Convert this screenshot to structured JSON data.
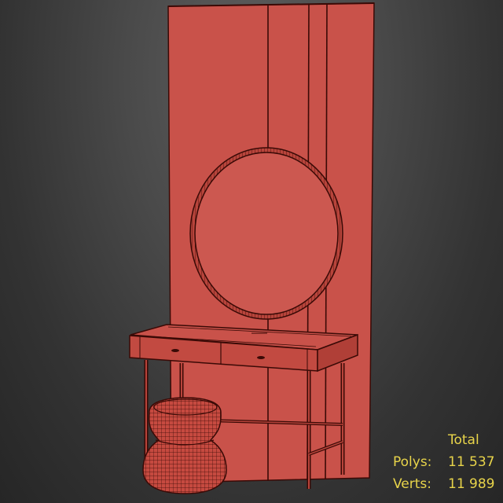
{
  "viewport": {
    "background_colors": [
      "#5e5e5e",
      "#262626"
    ],
    "wire_color": "#3a0a06",
    "fill_color": "#c9524a"
  },
  "scene": {
    "objects": [
      "wall-panel",
      "round-mirror",
      "vanity-desk",
      "pouf"
    ]
  },
  "stats": {
    "total_label": "Total",
    "polys_label": "Polys:",
    "polys_value": "11 537",
    "verts_label": "Verts:",
    "verts_value": "11 989",
    "text_color": "#e8d44a"
  }
}
